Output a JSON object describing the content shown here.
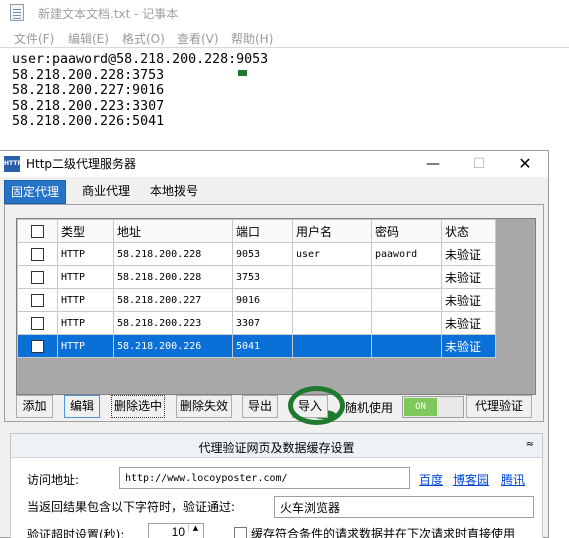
{
  "notepad": {
    "title": "新建文本文档.txt - 记事本",
    "menu": [
      "文件(F)",
      "编辑(E)",
      "格式(O)",
      "查看(V)",
      "帮助(H)"
    ],
    "lines": [
      "user:paaword@58.218.200.228:9053",
      "58.218.200.228:3753",
      "58.218.200.227:9016",
      "58.218.200.223:3307",
      "58.218.200.226:5041"
    ]
  },
  "proxy": {
    "title": "Http二级代理服务器",
    "icon_text": "HTTP",
    "window_buttons": {
      "minimize": "—",
      "maximize": "☐",
      "close": "✕"
    },
    "tabs": [
      "固定代理",
      "商业代理",
      "本地拨号"
    ],
    "active_tab": 0,
    "table": {
      "headers": [
        "",
        "类型",
        "地址",
        "端口",
        "用户名",
        "密码",
        "状态"
      ],
      "rows": [
        {
          "type": "HTTP",
          "address": "58.218.200.228",
          "port": "9053",
          "user": "user",
          "password": "paaword",
          "status": "未验证",
          "selected": false
        },
        {
          "type": "HTTP",
          "address": "58.218.200.228",
          "port": "3753",
          "user": "",
          "password": "",
          "status": "未验证",
          "selected": false
        },
        {
          "type": "HTTP",
          "address": "58.218.200.227",
          "port": "9016",
          "user": "",
          "password": "",
          "status": "未验证",
          "selected": false
        },
        {
          "type": "HTTP",
          "address": "58.218.200.223",
          "port": "3307",
          "user": "",
          "password": "",
          "status": "未验证",
          "selected": false
        },
        {
          "type": "HTTP",
          "address": "58.218.200.226",
          "port": "5041",
          "user": "",
          "password": "",
          "status": "未验证",
          "selected": true
        }
      ]
    },
    "buttons": {
      "add": "添加",
      "edit": "编辑",
      "delete_selected": "删除选中",
      "delete_invalid": "删除失效",
      "export": "导出",
      "import": "导入",
      "verify": "代理验证"
    },
    "random_use_label": "随机使用",
    "toggle_label": "ON",
    "section": {
      "title": "代理验证网页及数据缓存设置",
      "collapse_icon": "chevron-double-up-icon",
      "collapse_glyph": "≈",
      "url_label": "访问地址:",
      "url_value": "http://www.locoyposter.com/",
      "links": [
        "百度",
        "博客园",
        "腾讯"
      ],
      "contains_label": "当返回结果包含以下字符时，验证通过:",
      "contains_value": "火车浏览器",
      "timeout_label": "验证超时设置(秒):",
      "timeout_value": "10",
      "cache_label": "缓存符合条件的请求数据并在下次请求时直接使用"
    }
  },
  "colors": {
    "selection_blue": "#0a6fd6",
    "active_tab_blue": "#2773c8",
    "annotation_green": "#1f7a2e",
    "toggle_green": "#7fc95a",
    "link_blue": "#0046d5"
  }
}
